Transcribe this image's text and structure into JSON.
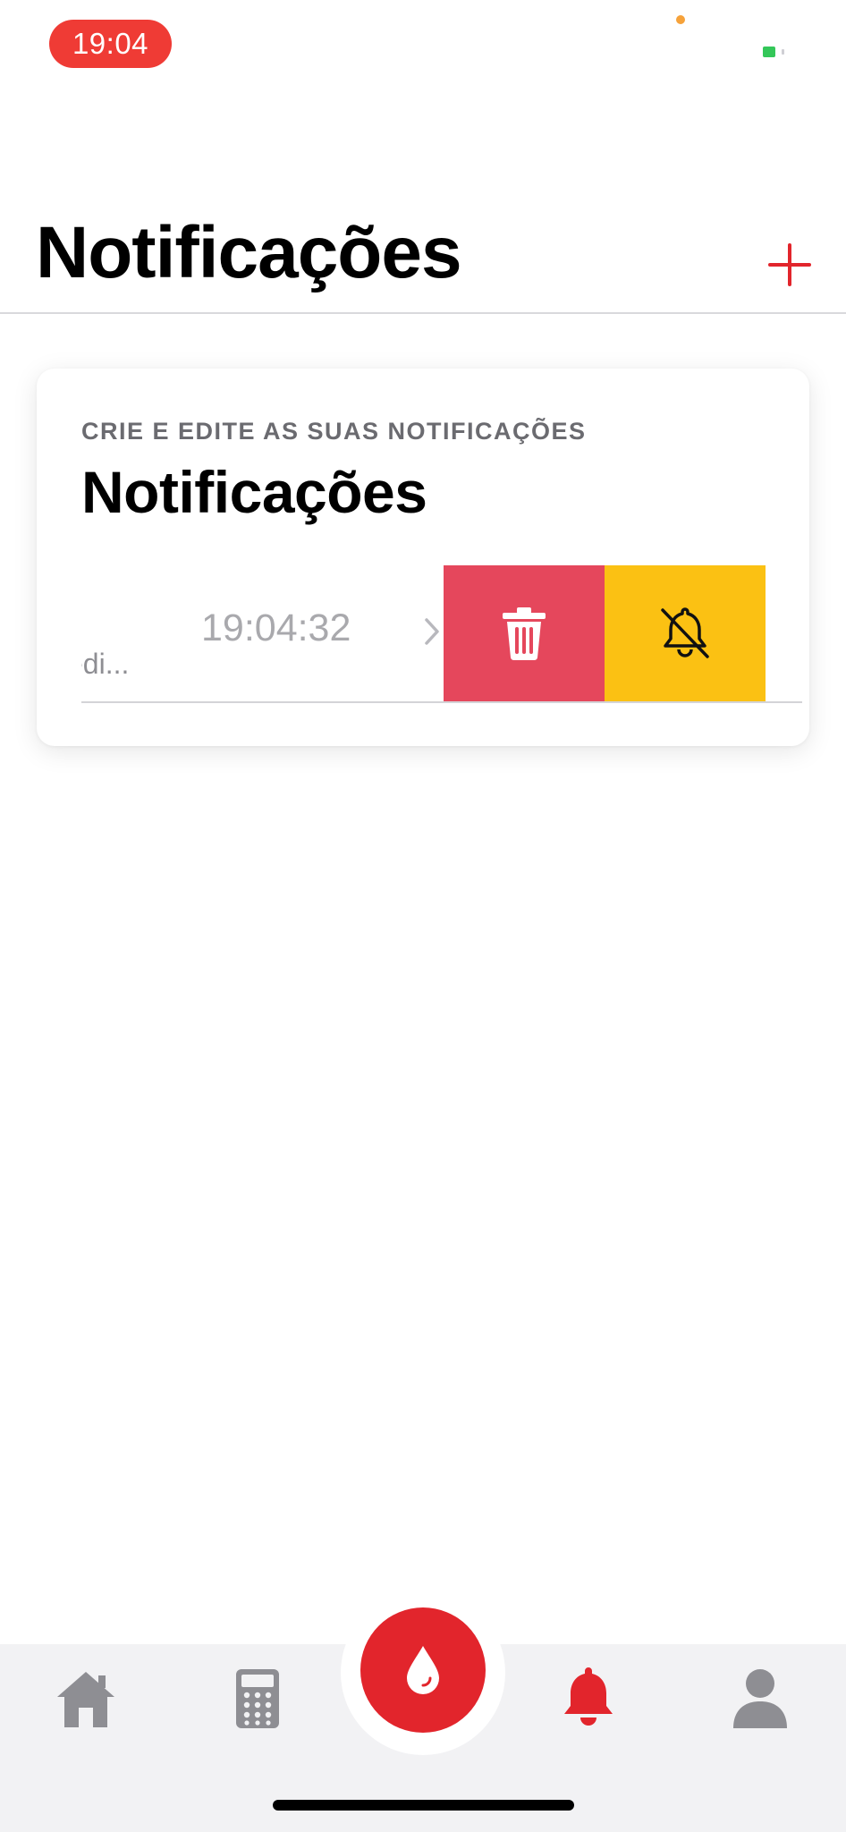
{
  "status_bar": {
    "time": "19:04"
  },
  "header": {
    "title": "Notificações"
  },
  "card": {
    "overline": "CRIE E EDITE AS SUAS NOTIFICAÇÕES",
    "title": "Notificações",
    "notification": {
      "name": "edi...",
      "time": "19:04:32"
    },
    "actions": {
      "delete_icon": "trash-icon",
      "mute_icon": "bell-slash-icon",
      "delete_color": "#e5475c",
      "mute_color": "#fbc113"
    }
  },
  "tab_bar": {
    "items": [
      "home-icon",
      "calculator-icon",
      "blood-drop-icon",
      "bell-icon",
      "person-icon"
    ],
    "active": "bell-icon",
    "accent": "#e2252c",
    "inactive_color": "#8e8e93"
  },
  "colors": {
    "accent": "#e2252c",
    "status_pill": "#ef3b35"
  }
}
